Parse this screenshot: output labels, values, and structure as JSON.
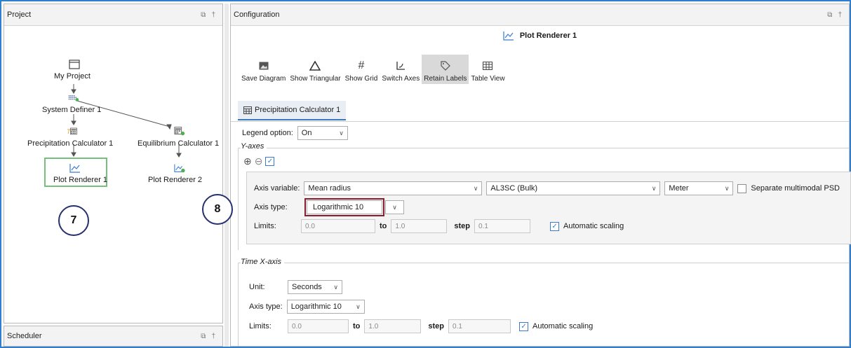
{
  "project": {
    "title": "Project",
    "nodes": {
      "my_project": "My Project",
      "system_definer": "System Definer 1",
      "precipitation_calc": "Precipitation Calculator 1",
      "equilibrium_calc": "Equilibrium Calculator 1",
      "plot_renderer_1": "Plot Renderer 1",
      "plot_renderer_2": "Plot Renderer 2"
    },
    "callout_7": "7",
    "callout_8": "8"
  },
  "scheduler": {
    "title": "Scheduler"
  },
  "configuration": {
    "title": "Configuration",
    "plot_title": "Plot Renderer 1",
    "toolbar": [
      {
        "label": "Save Diagram",
        "icon": "image-icon"
      },
      {
        "label": "Show Triangular",
        "icon": "triangle-icon"
      },
      {
        "label": "Show Grid",
        "icon": "grid-icon"
      },
      {
        "label": "Switch Axes",
        "icon": "switch-axes-icon"
      },
      {
        "label": "Retain Labels",
        "icon": "tag-icon"
      },
      {
        "label": "Table View",
        "icon": "table-icon"
      }
    ],
    "tab": "Precipitation Calculator 1",
    "legend": {
      "label": "Legend option:",
      "value": "On"
    },
    "y_axes": {
      "title": "Y-axes",
      "axis_variable_label": "Axis variable:",
      "axis_variable": "Mean radius",
      "phase": "AL3SC (Bulk)",
      "unit": "Meter",
      "separate_psd": "Separate multimodal PSD",
      "axis_type_label": "Axis type:",
      "axis_type": "Logarithmic 10",
      "limits_label": "Limits:",
      "limit_from": "0.0",
      "to_label": "to",
      "limit_to": "1.0",
      "step_label": "step",
      "step": "0.1",
      "auto_scaling": "Automatic scaling"
    },
    "time_x_axis": {
      "title": "Time X-axis",
      "unit_label": "Unit:",
      "unit": "Seconds",
      "axis_type_label": "Axis type:",
      "axis_type": "Logarithmic 10",
      "limits_label": "Limits:",
      "limit_from": "0.0",
      "to_label": "to",
      "limit_to": "1.0",
      "step_label": "step",
      "step": "0.1",
      "auto_scaling": "Automatic scaling"
    }
  },
  "colors": {
    "selection_green": "#76c07e",
    "callout_navy": "#27306f",
    "highlight_red": "#8a1d2c",
    "accent_blue": "#3b7ad0"
  }
}
